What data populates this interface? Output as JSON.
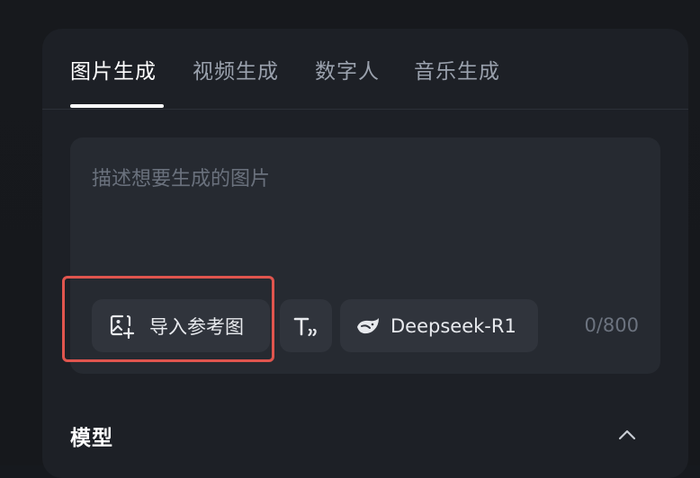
{
  "tabs": [
    {
      "label": "图片生成",
      "active": true
    },
    {
      "label": "视频生成",
      "active": false
    },
    {
      "label": "数字人",
      "active": false
    },
    {
      "label": "音乐生成",
      "active": false
    }
  ],
  "prompt": {
    "placeholder": "描述想要生成的图片",
    "value": "",
    "counter": "0/800"
  },
  "toolbar": {
    "import_reference_label": "导入参考图",
    "model_chip_label": "Deepseek-R1"
  },
  "icons": {
    "import_reference": "image-add-icon",
    "text_format": "text-format-icon",
    "model": "deepseek-whale-icon",
    "collapse": "chevron-up-icon"
  },
  "model_section": {
    "title": "模型"
  },
  "colors": {
    "highlight": "#e0554e",
    "panel": "#1d2026",
    "active_tab": "#ffffff",
    "inactive_tab": "#9aa1ad"
  }
}
